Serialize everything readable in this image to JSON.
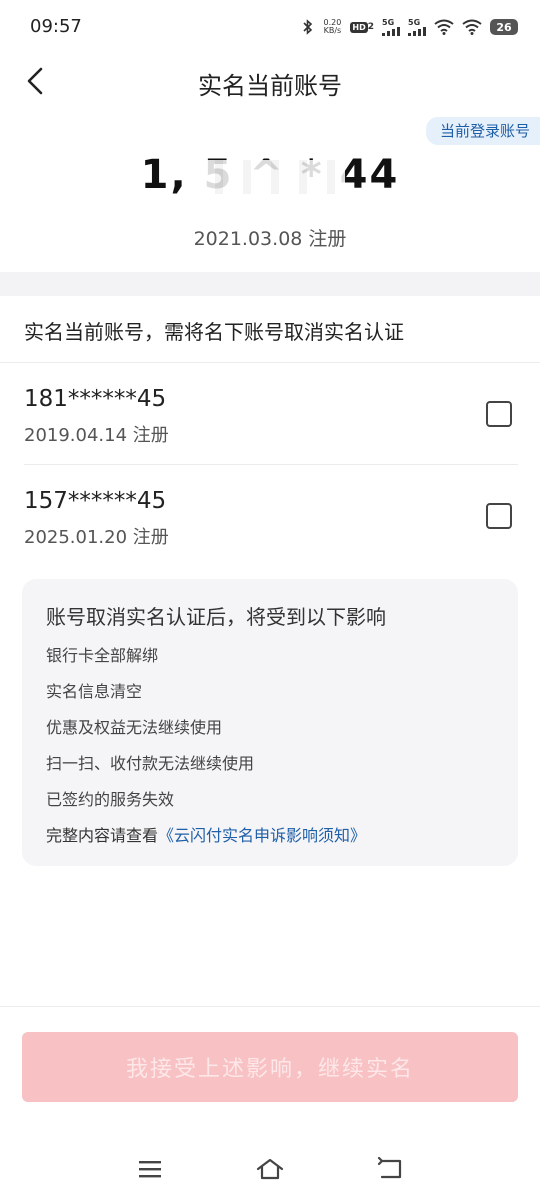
{
  "status_bar": {
    "time": "09:57",
    "net_speed_value": "0.20",
    "net_speed_unit": "KB/s",
    "hd_label": "HD",
    "hd_sub": "2",
    "sig1_label": "5G",
    "sig2_label": "5G",
    "battery": "26",
    "icons": [
      "bluetooth-icon",
      "wifi-icon",
      "wifi-icon"
    ]
  },
  "nav": {
    "title": "实名当前账号",
    "back_icon": "chevron-left-icon"
  },
  "current_account": {
    "badge": "当前登录账号",
    "number": "1, 5 ^ * 44",
    "registered": "2021.03.08 注册"
  },
  "section_heading": "实名当前账号，需将名下账号取消实名认证",
  "accounts": [
    {
      "number": "181******45",
      "registered": "2019.04.14 注册",
      "checked": false
    },
    {
      "number": "157******45",
      "registered": "2025.01.20 注册",
      "checked": false
    }
  ],
  "impact": {
    "title": "账号取消实名认证后，将受到以下影响",
    "items": [
      "银行卡全部解绑",
      "实名信息清空",
      "优惠及权益无法继续使用",
      "扫一扫、收付款无法继续使用",
      "已签约的服务失效"
    ],
    "more_prefix": "完整内容请查看",
    "more_link": "《云闪付实名申诉影响须知》"
  },
  "continue_button": "我接受上述影响，继续实名",
  "colors": {
    "accent_blue": "#1f5fa8",
    "button_disabled": "#f8c1c3",
    "badge_bg": "#e6f0fb"
  },
  "system_nav": {
    "icons": [
      "menu-icon",
      "home-icon",
      "back-icon"
    ]
  }
}
